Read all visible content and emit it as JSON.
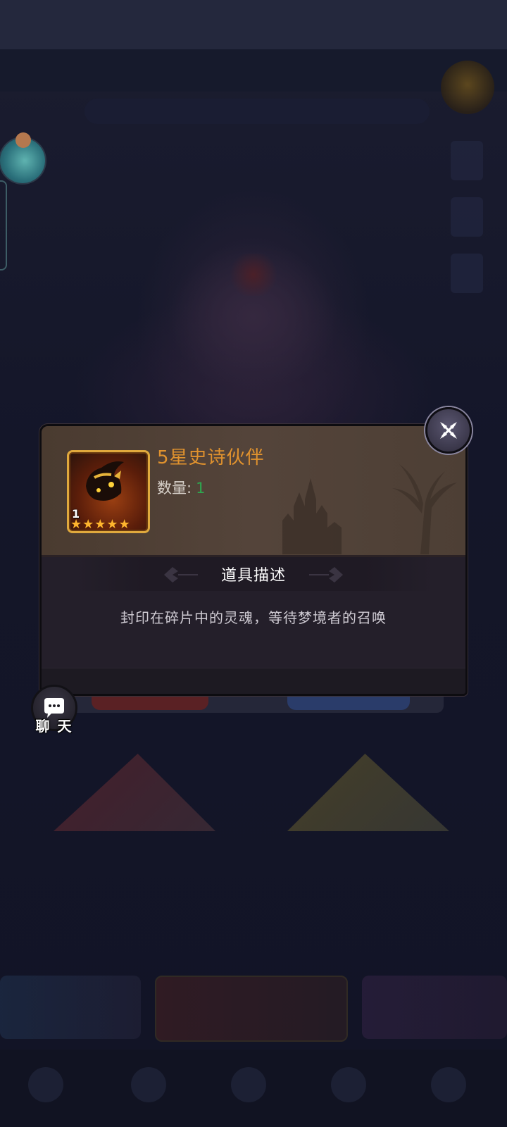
{
  "dialog": {
    "item_title": "5星史诗伙伴",
    "quantity_label": "数量:",
    "quantity_value": "1",
    "icon_count": "1",
    "star_rating": 5,
    "section_title": "道具描述",
    "description": "封印在碎片中的灵魂，等待梦境者的召唤"
  },
  "chat": {
    "label": "聊 天"
  },
  "icons": {
    "close": "close-icon",
    "chat": "chat-bubble-icon",
    "star": "star-icon"
  },
  "colors": {
    "title_orange": "#e0922e",
    "quantity_green": "#2ea84f",
    "star_gold": "#ffb52e",
    "icon_border_gold": "#e0a93d"
  }
}
